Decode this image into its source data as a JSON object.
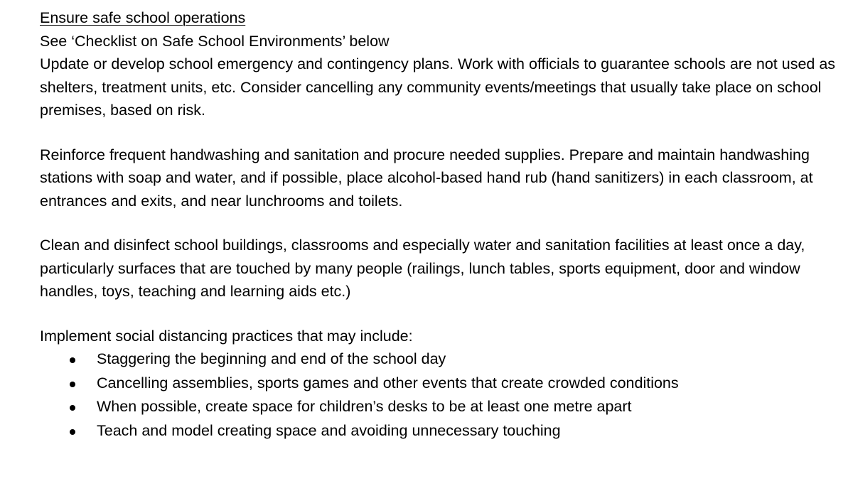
{
  "document": {
    "heading": "Ensure safe school operations",
    "see_also": "See ‘Checklist on Safe School Environments’ below",
    "paragraphs": [
      "Update or develop school emergency and contingency plans. Work with officials to guarantee schools are not used as shelters, treatment units, etc. Consider cancelling any community events/meetings that usually take place on school premises, based on risk.",
      "Reinforce frequent handwashing and sanitation and procure needed supplies. Prepare and maintain handwashing stations with soap and water, and if possible, place alcohol-based hand rub (hand sanitizers) in each classroom, at entrances and exits, and near lunchrooms and toilets.",
      "Clean and disinfect school buildings, classrooms and especially water and sanitation facilities at least once a day, particularly surfaces that are touched by many people (railings, lunch tables, sports equipment, door and window handles, toys, teaching and learning aids etc.)"
    ],
    "list_intro": "Implement social distancing practices that may include:",
    "bullets": [
      "Staggering the beginning and end of the school day",
      "Cancelling assemblies, sports games and other events that create crowded conditions",
      "When possible, create space for children’s desks to be at least one metre apart",
      "Teach and model creating space and avoiding unnecessary touching"
    ]
  }
}
